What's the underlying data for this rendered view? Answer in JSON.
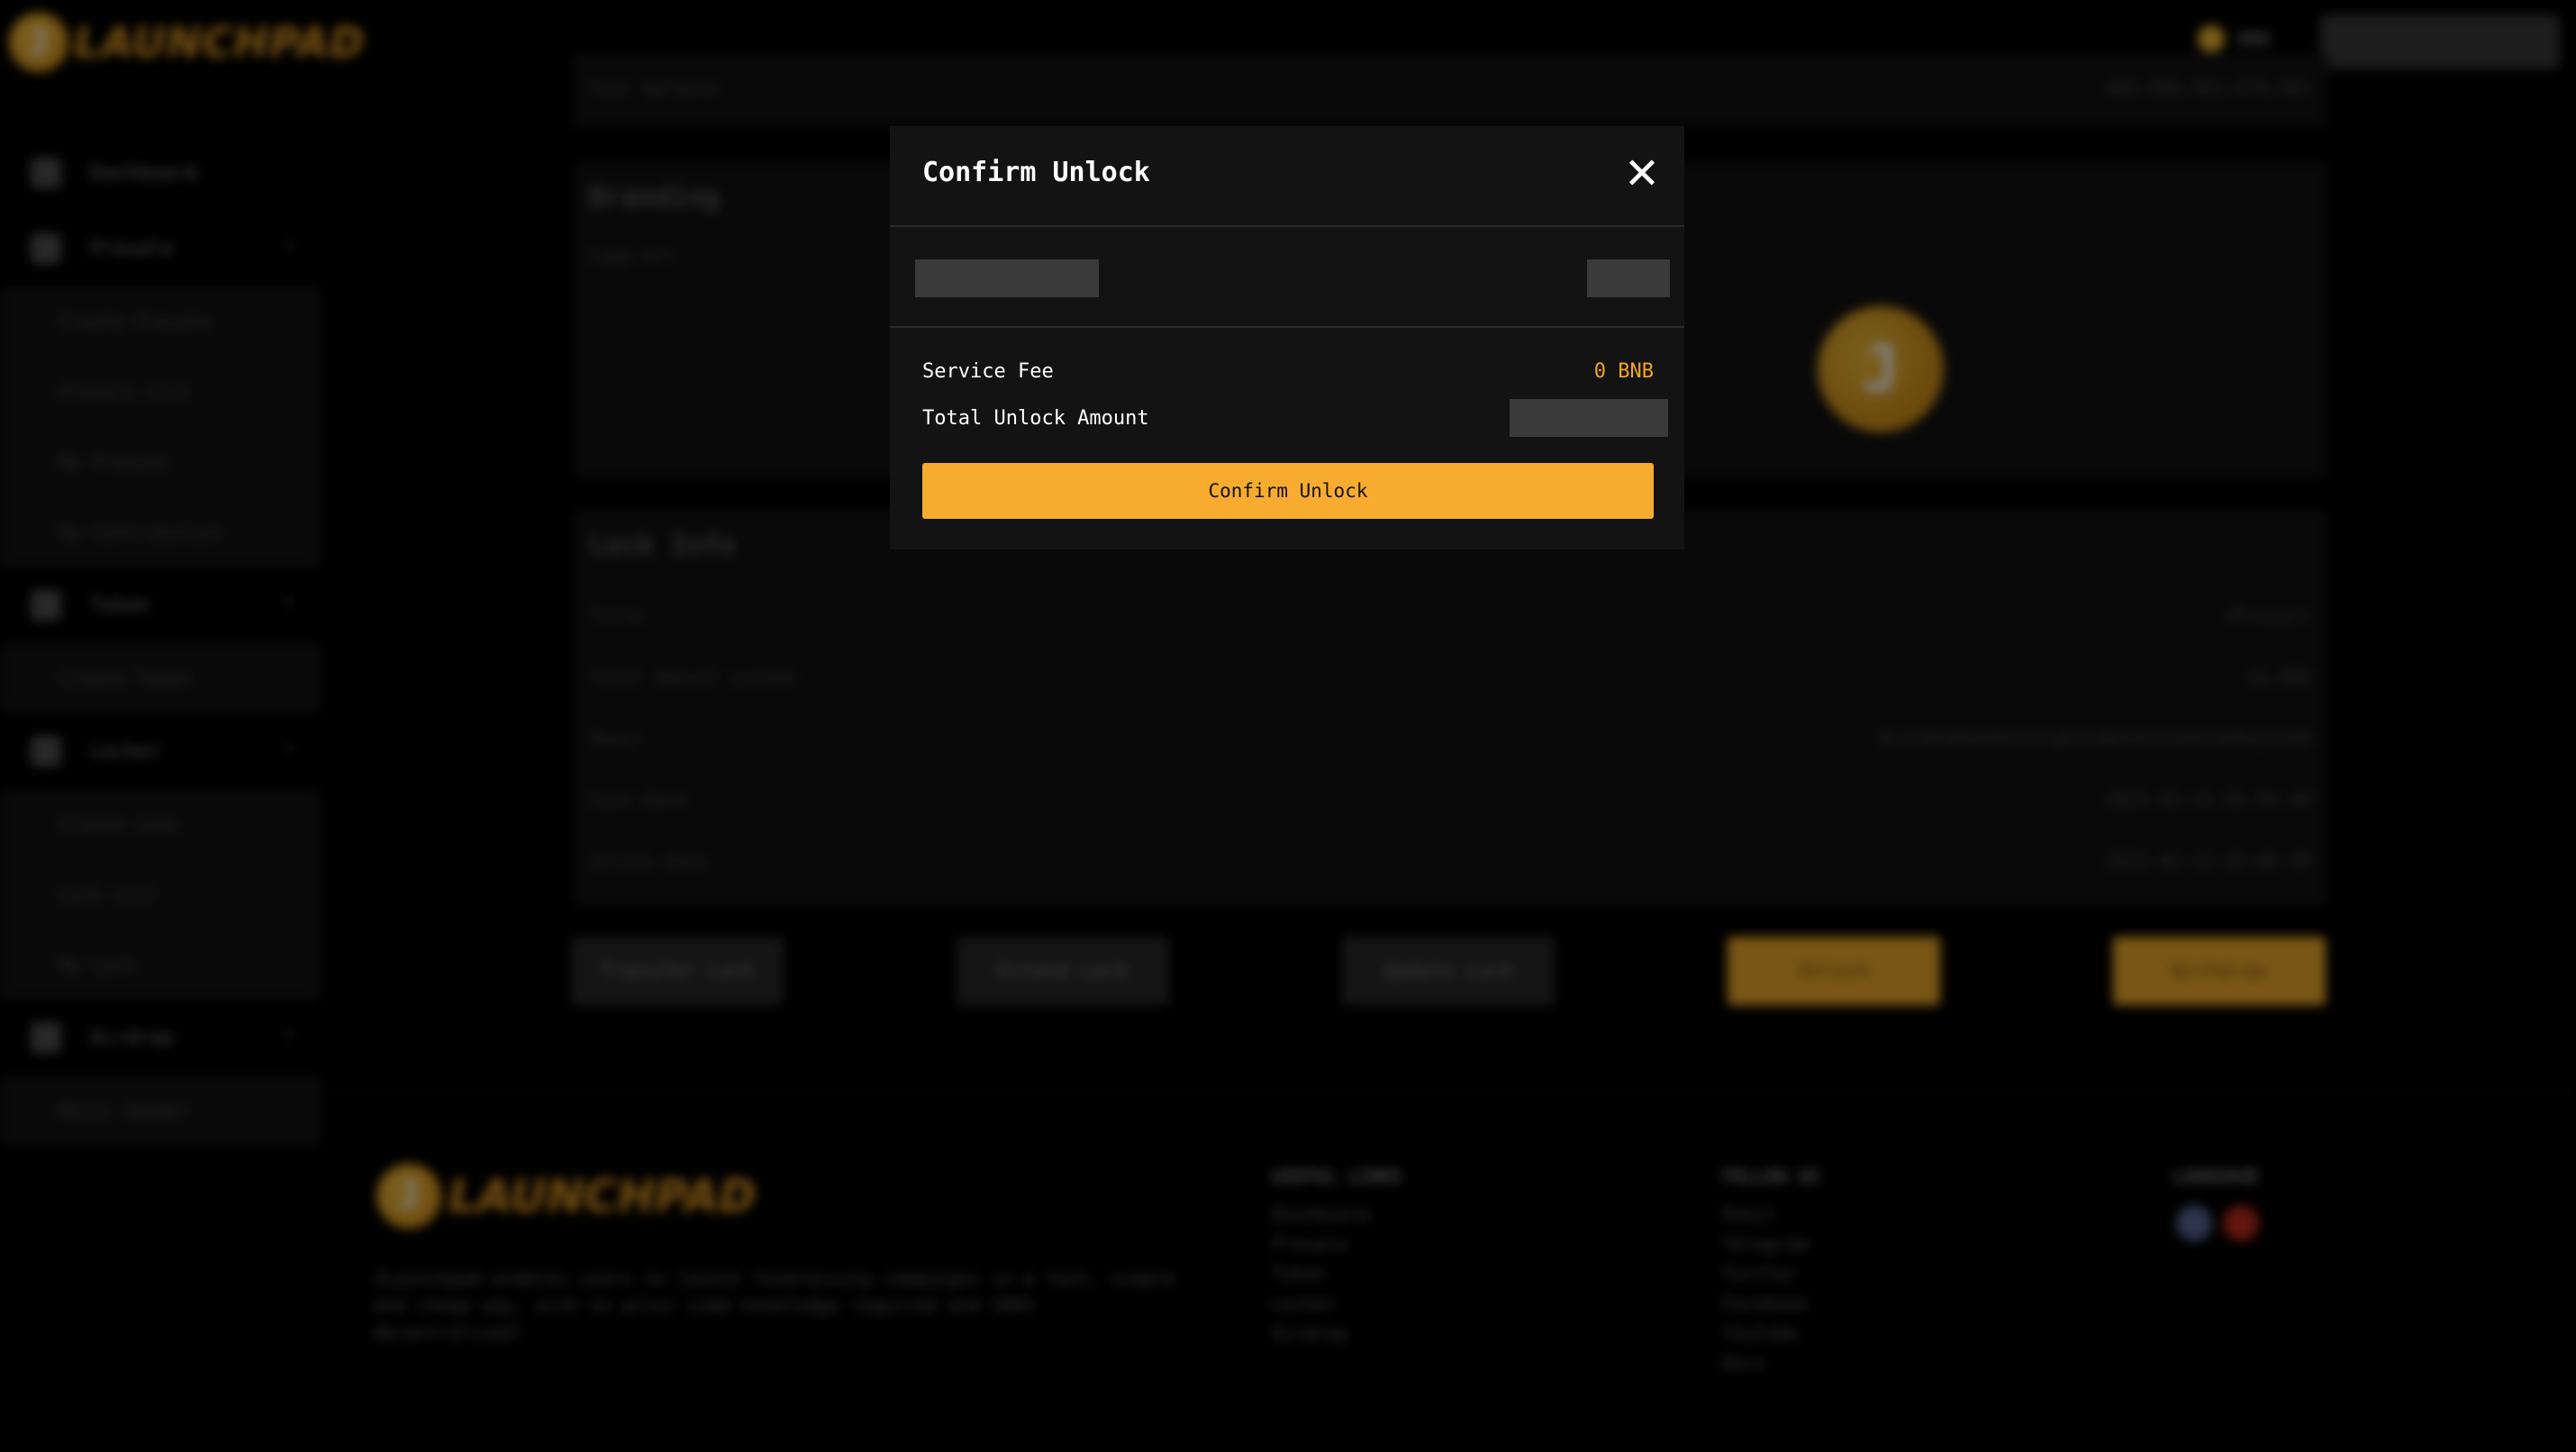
{
  "app": {
    "brand": "LAUNCHPAD",
    "logo_letter": "J"
  },
  "header": {
    "network_label": "BNB"
  },
  "sidebar": {
    "items": [
      {
        "label": "Dashboard",
        "icon": "dashboard-icon"
      },
      {
        "label": "Presale",
        "icon": "rocket-icon",
        "subitems": [
          "Create Presale",
          "Presale List",
          "My Presale",
          "My Contribution"
        ]
      },
      {
        "label": "Token",
        "icon": "token-icon",
        "subitems": [
          "Create Token"
        ]
      },
      {
        "label": "Locker",
        "icon": "lock-icon",
        "subitems": [
          "Create Lock",
          "Lock List",
          "My Lock"
        ]
      },
      {
        "label": "Airdrop",
        "icon": "airdrop-icon",
        "subitems": [
          "Multi Sender"
        ]
      }
    ]
  },
  "main": {
    "top_row": {
      "label": "Your balance",
      "value": "999,999,991,970,991"
    },
    "branding": {
      "title": "Branding",
      "logo_url_label": "Logo Url"
    },
    "lock_info": {
      "title": "Lock Info",
      "rows": [
        {
          "label": "Title",
          "value": "JProject"
        },
        {
          "label": "Total Amount Locked",
          "value": "10,000"
        },
        {
          "label": "Owner",
          "value": "0x2f9530b4d9fd7fa67e301b5a1b8323d9a22338"
        },
        {
          "label": "Lock Date",
          "value": "2025-02-15 05:04 AM"
        },
        {
          "label": "Unlock Date",
          "value": "2025-02-15 05:06 PM"
        }
      ]
    },
    "actions": [
      "Transfer Lock",
      "Extend Lock",
      "Update Lock",
      "Unlock",
      "Withdraw"
    ]
  },
  "footer": {
    "description": "JLaunchpad enables users to launch fundraising campaigns in a fast, simple and cheap way, with no prior code knowledge required and 100% decentralized!",
    "useful_links": {
      "title": "USEFUL LINKS",
      "links": [
        "Dashboard",
        "Presale",
        "Token",
        "Locker",
        "Airdrop"
      ]
    },
    "follow_us": {
      "title": "FOLLOW US",
      "links": [
        "Email",
        "Telegram",
        "Twitter",
        "Facebook",
        "Youtube",
        "Docs"
      ]
    },
    "language": {
      "title": "LANGUAGE"
    }
  },
  "modal": {
    "title": "Confirm Unlock",
    "service_fee_label": "Service Fee",
    "service_fee_value": "0 BNB",
    "total_unlock_label": "Total Unlock Amount",
    "confirm_label": "Confirm Unlock"
  },
  "colors": {
    "accent": "#f7ac30",
    "fee": "#f5a623",
    "modal_bg": "#131313"
  }
}
